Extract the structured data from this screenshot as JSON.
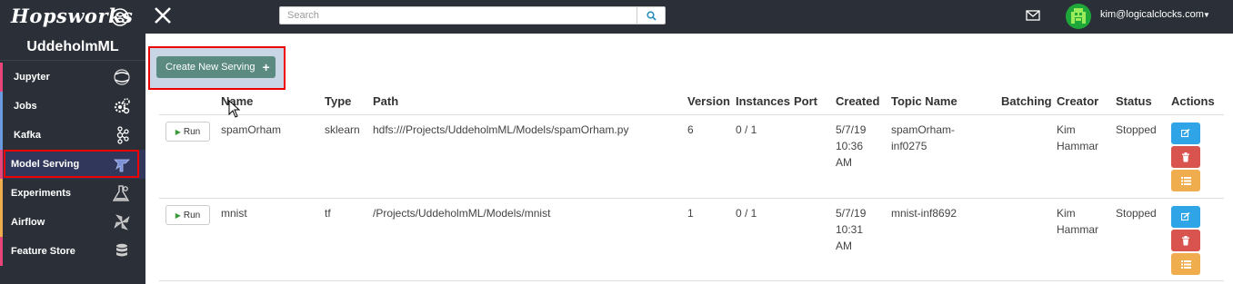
{
  "app": {
    "logo_text": "Hopsworks"
  },
  "search": {
    "placeholder": "Search"
  },
  "user": {
    "email": "kim@logicalclocks.com"
  },
  "sidebar": {
    "project": "UddeholmML",
    "items": [
      {
        "label": "Jupyter",
        "icon": "jupyter-icon",
        "accent": "#e8457a"
      },
      {
        "label": "Jobs",
        "icon": "gears-icon",
        "accent": "#6a9be0"
      },
      {
        "label": "Kafka",
        "icon": "kafka-icon",
        "accent": "#6a9be0"
      },
      {
        "label": "Model Serving",
        "icon": "serving-icon",
        "accent": "#e8457a"
      },
      {
        "label": "Experiments",
        "icon": "flask-icon",
        "accent": "#f0ad4e"
      },
      {
        "label": "Airflow",
        "icon": "pinwheel-icon",
        "accent": "#f0ad4e"
      },
      {
        "label": "Feature Store",
        "icon": "database-icon",
        "accent": "#e8457a"
      }
    ]
  },
  "main": {
    "create_label": "Create New Serving",
    "columns": [
      "Name",
      "Type",
      "Path",
      "Version",
      "Instances",
      "Port",
      "Created",
      "Topic Name",
      "Batching",
      "Creator",
      "Status",
      "Actions"
    ],
    "rows": [
      {
        "run": "Run",
        "name": "spamOrham",
        "type": "sklearn",
        "path": "hdfs:///Projects/UddeholmML/Models/spamOrham.py",
        "version": "6",
        "instances": "0 / 1",
        "port": "",
        "created_l1": "5/7/19",
        "created_l2": "10:36",
        "created_l3": "AM",
        "topic_l1": "spamOrham-",
        "topic_l2": "inf0275",
        "batching": "",
        "creator_l1": "Kim",
        "creator_l2": "Hammar",
        "status": "Stopped"
      },
      {
        "run": "Run",
        "name": "mnist",
        "type": "tf",
        "path": "/Projects/UddeholmML/Models/mnist",
        "version": "1",
        "instances": "0 / 1",
        "port": "",
        "created_l1": "5/7/19",
        "created_l2": "10:31",
        "created_l3": "AM",
        "topic_l1": "mnist-inf8692",
        "topic_l2": "",
        "batching": "",
        "creator_l1": "Kim",
        "creator_l2": "Hammar",
        "status": "Stopped"
      }
    ]
  },
  "colors": {
    "topbar": "#2b3038",
    "create_button": "#5a8a80",
    "highlight": "#e00000"
  }
}
